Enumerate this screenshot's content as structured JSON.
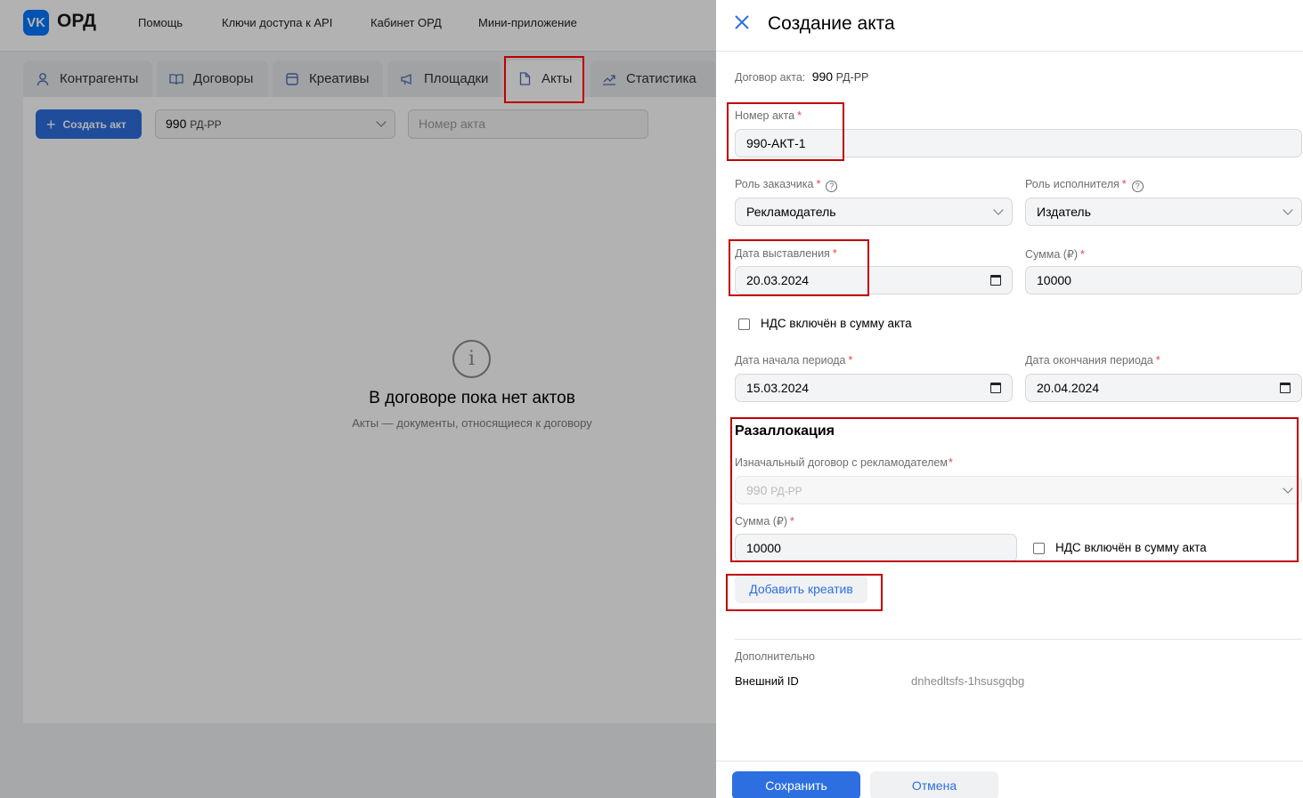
{
  "app": {
    "logo_text": "VK",
    "brand": "ОРД",
    "nav": [
      "Помощь",
      "Ключи доступа к API",
      "Кабинет ОРД",
      "Мини-приложение"
    ]
  },
  "tabs": [
    {
      "label": "Контрагенты",
      "icon": "person-icon"
    },
    {
      "label": "Договоры",
      "icon": "book-icon"
    },
    {
      "label": "Креативы",
      "icon": "frame-icon"
    },
    {
      "label": "Площадки",
      "icon": "megaphone-icon"
    },
    {
      "label": "Акты",
      "icon": "document-icon",
      "active": true
    },
    {
      "label": "Статистика",
      "icon": "chart-icon"
    }
  ],
  "toolbar": {
    "create_label": "Создать акт",
    "contract_select_number": "990",
    "contract_select_suffix": "РД-РР",
    "act_number_placeholder": "Номер акта"
  },
  "empty_state": {
    "title": "В договоре пока нет актов",
    "subtitle": "Акты — документы, относящиеся к договору"
  },
  "drawer": {
    "title": "Создание акта",
    "contract_label": "Договор акта:",
    "contract_number": "990",
    "contract_suffix": "РД-РР",
    "act_number": {
      "label": "Номер акта",
      "value": "990-АКТ-1"
    },
    "customer_role": {
      "label": "Роль заказчика",
      "value": "Рекламодатель"
    },
    "executor_role": {
      "label": "Роль исполнителя",
      "value": "Издатель"
    },
    "issue_date": {
      "label": "Дата выставления",
      "value": "20.03.2024"
    },
    "amount": {
      "label": "Сумма (₽)",
      "value": "10000"
    },
    "vat_label": "НДС включён в сумму акта",
    "period_start": {
      "label": "Дата начала периода",
      "value": "15.03.2024"
    },
    "period_end": {
      "label": "Дата окончания периода",
      "value": "20.04.2024"
    },
    "reallocation": {
      "title": "Разаллокация",
      "contract_label": "Изначальный договор с рекламодателем",
      "contract_number": "990",
      "contract_suffix": "РД-РР",
      "amount_label": "Сумма (₽)",
      "amount_value": "10000",
      "vat_label": "НДС включён в сумму акта"
    },
    "add_creative_label": "Добавить креатив",
    "additional": {
      "title": "Дополнительно",
      "external_id_label": "Внешний ID",
      "external_id_value": "dnhedltsfs-1hsusgqbg"
    },
    "save_label": "Сохранить",
    "cancel_label": "Отмена"
  },
  "colors": {
    "accent": "#2d6fe0",
    "highlight": "#c00000",
    "required": "#e64646"
  }
}
